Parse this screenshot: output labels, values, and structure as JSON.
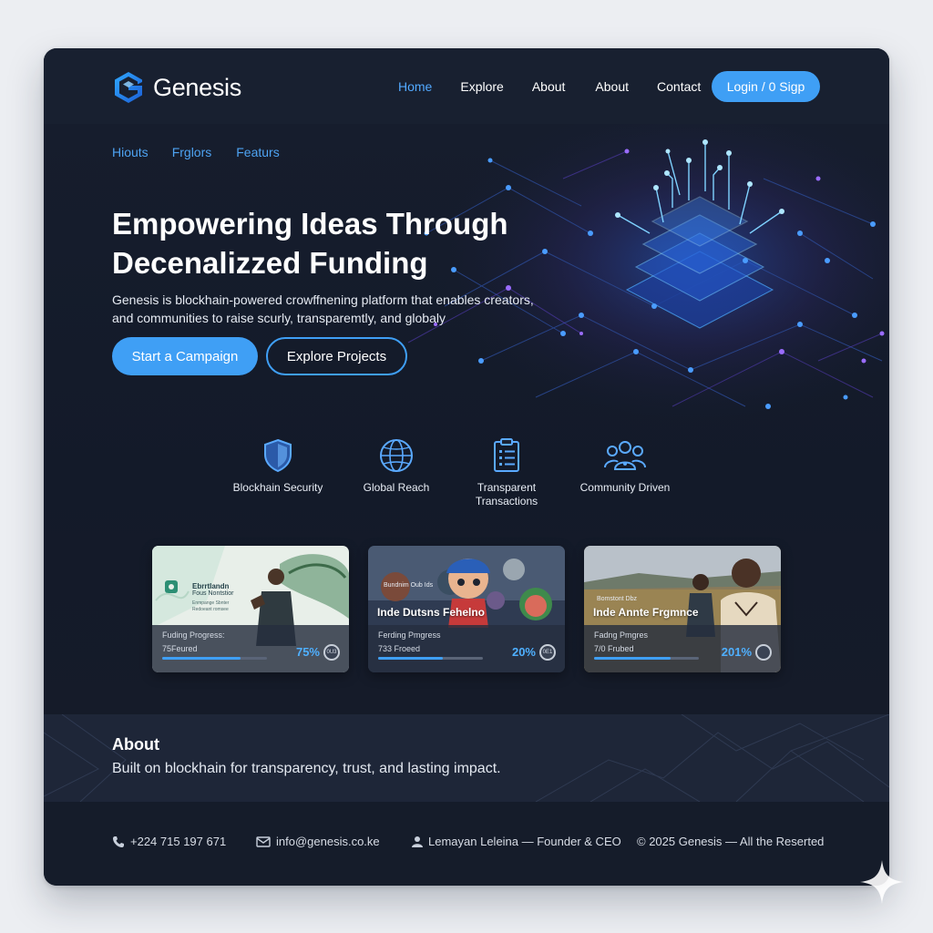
{
  "brand": {
    "name": "Genesis",
    "accent": "#3f9ff5",
    "link_color": "#52a9ff"
  },
  "nav": {
    "links": [
      {
        "label": "Home",
        "active": true
      },
      {
        "label": "Explore",
        "active": false
      },
      {
        "label": "About",
        "active": false
      },
      {
        "label": "About",
        "active": false
      },
      {
        "label": "Contact",
        "active": false
      }
    ],
    "login_label": "Login / 0 Sigp"
  },
  "subnav": {
    "links": [
      "Hiouts",
      "Frglors",
      "Featurs"
    ]
  },
  "hero": {
    "title_lines": [
      "Empowering Ideas Through",
      "Decenalizzed Funding"
    ],
    "description_lines": [
      "Genesis is blockhain-powered crowffnening platform that enables creators,",
      "and communities to raise scurly, transparemtly, and globaly"
    ],
    "primary_cta": "Start a Campaign",
    "secondary_cta": "Explore Projects"
  },
  "features": [
    {
      "icon": "shield-icon",
      "label_lines": [
        "Blockhain Security"
      ]
    },
    {
      "icon": "globe-icon",
      "label_lines": [
        "Global Reach"
      ]
    },
    {
      "icon": "clipboard-icon",
      "label_lines": [
        "Transparent",
        "Transactions"
      ]
    },
    {
      "icon": "community-icon",
      "label_lines": [
        "Community Driven"
      ]
    }
  ],
  "campaigns": [
    {
      "tag_lines": [
        "Ebrrtlandn",
        "Fous Nontstior",
        "Enmpange Sbnter",
        "Redoeant romsee"
      ],
      "title": "",
      "progress_label": "Fuding Progress:",
      "status": "75Feured",
      "percent_text": "75%",
      "progress": 0.75,
      "coin": "0U3"
    },
    {
      "tag_lines": [
        "Bundnim Oub Ids"
      ],
      "title": "Inde Dutsns Fehelno",
      "progress_label": "Ferding Pmgress",
      "status": "733 Froeed",
      "percent_text": "20%",
      "progress": 0.62,
      "coin": "0E1"
    },
    {
      "tag_lines": [
        "Bomstont Dbz"
      ],
      "title": "Inde Annte Frgmnce",
      "progress_label": "Fadng Pmgres",
      "status": "7/0 Frubed",
      "percent_text": "201%",
      "progress": 0.73,
      "coin": ""
    }
  ],
  "about": {
    "title": "About",
    "text": "Built on blockhain for transparency, trust, and lasting impact."
  },
  "footer": {
    "phone": "+224 715 197 671",
    "email": "info@genesis.co.ke",
    "founder": "Lemayan Leleina — Founder & CEO",
    "copyright": "© 2025 Genesis — All the Reserted"
  }
}
